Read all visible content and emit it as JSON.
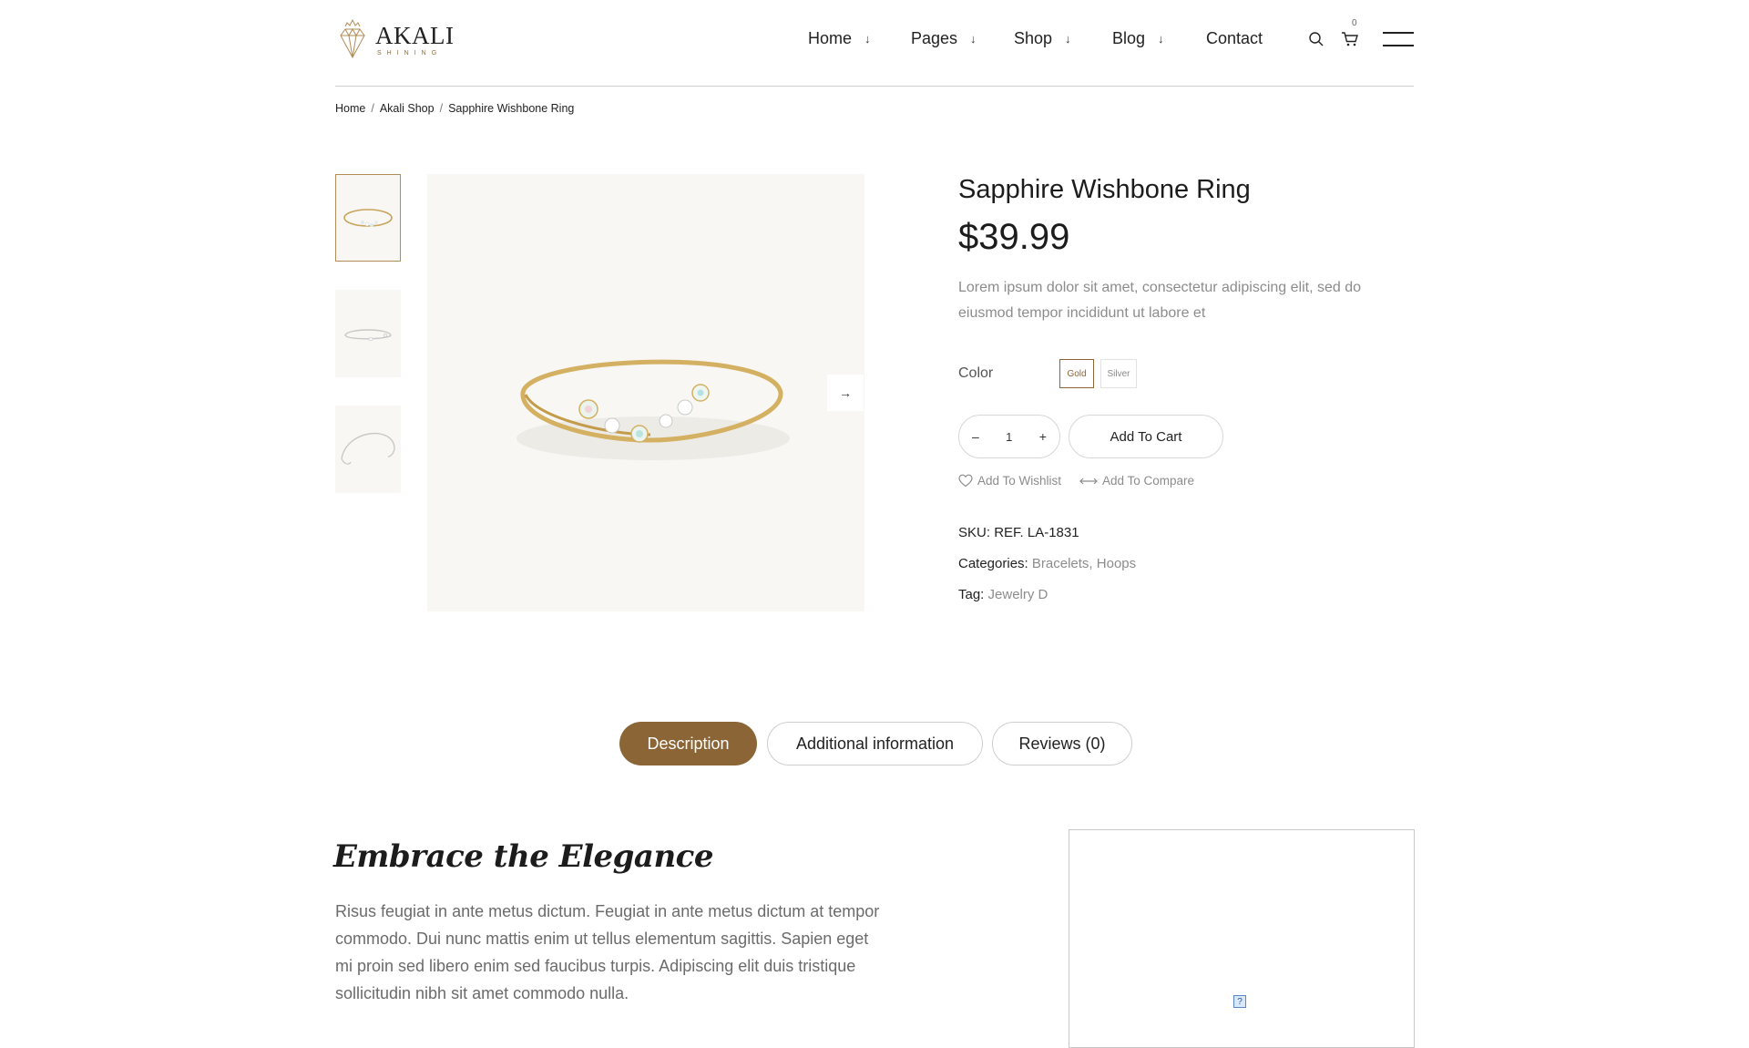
{
  "brand": {
    "name": "AKALI",
    "tagline": "SHINING"
  },
  "nav": {
    "items": [
      {
        "label": "Home",
        "arrow": "↓"
      },
      {
        "label": "Pages",
        "arrow": "↓"
      },
      {
        "label": "Shop",
        "arrow": "↓"
      },
      {
        "label": "Blog",
        "arrow": "↓"
      },
      {
        "label": "Contact"
      }
    ]
  },
  "header": {
    "cart_count": "0"
  },
  "breadcrumb": {
    "items": [
      "Home",
      "Akali Shop",
      "Sapphire Wishbone Ring"
    ],
    "separator": "/"
  },
  "gallery": {
    "thumbnail_count": 3,
    "active_index": 0
  },
  "product": {
    "title": "Sapphire Wishbone Ring",
    "price": "$39.99",
    "short_description": "Lorem ipsum dolor sit amet, consectetur adipiscing elit, sed do eiusmod tempor incididunt ut labore et",
    "color_label": "Color",
    "colors": [
      "Gold",
      "Silver"
    ],
    "selected_color": "Gold",
    "quantity": "1",
    "qty_minus": "–",
    "qty_plus": "+",
    "add_to_cart": "Add To Cart",
    "add_to_wishlist": "Add To Wishlist",
    "add_to_compare": "Add To Compare",
    "sku_label": "SKU:",
    "sku_value": "REF. LA-1831",
    "categories_label": "Categories:",
    "categories": [
      "Bracelets",
      "Hoops"
    ],
    "tag_label": "Tag:",
    "tag_value": "Jewelry D"
  },
  "tabs": [
    {
      "label": "Description",
      "active": true
    },
    {
      "label": "Additional information",
      "active": false
    },
    {
      "label": "Reviews (0)",
      "active": false
    }
  ],
  "description": {
    "heading": "Embrace the Elegance",
    "body": "Risus feugiat in ante metus dictum. Feugiat in ante metus dictum at tempor commodo. Dui nunc mattis enim ut tellus elementum sagittis. Sapien eget mi proin sed libero enim sed faucibus turpis. Adipiscing elit duis tristique sollicitudin nibh sit amet commodo nulla."
  },
  "colors": {
    "accent": "#8b6535",
    "text": "#1c1c1c",
    "muted": "#8c8c8c",
    "image_bg": "#f8f7f4"
  }
}
